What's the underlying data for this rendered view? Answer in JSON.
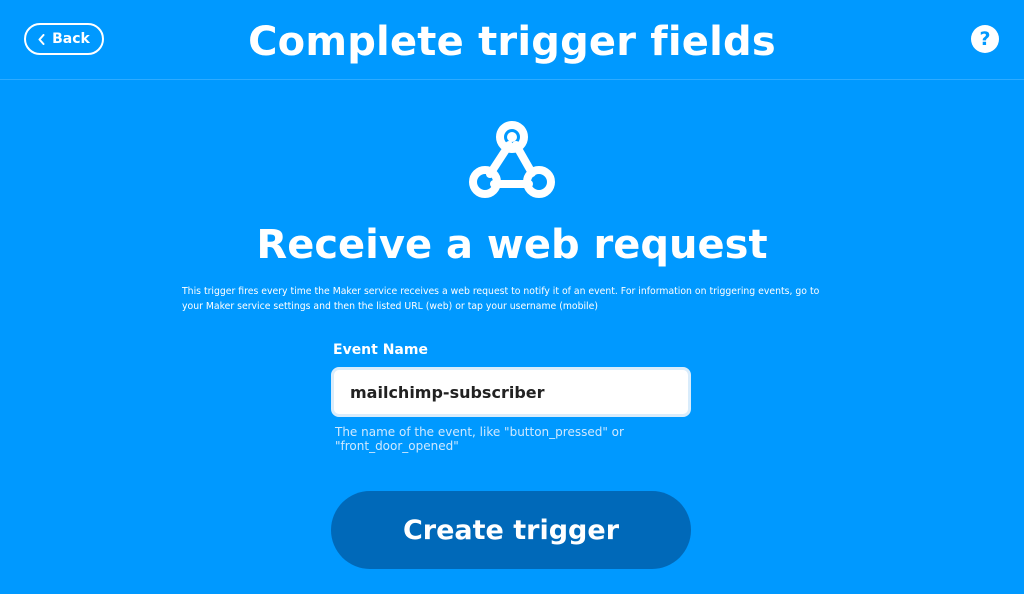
{
  "header": {
    "back_label": "Back",
    "title": "Complete trigger fields",
    "help_label": "?"
  },
  "trigger": {
    "icon": "webhook-icon",
    "title": "Receive a web request",
    "description": "This trigger fires every time the Maker service receives a web request to notify it of an event. For information on triggering events, go to your Maker service settings and then the listed URL (web) or tap your username (mobile)"
  },
  "form": {
    "event_name_label": "Event Name",
    "event_name_value": "mailchimp-subscriber",
    "event_name_help": "The name of the event, like \"button_pressed\" or \"front_door_opened\""
  },
  "actions": {
    "create_label": "Create trigger"
  },
  "colors": {
    "background": "#0099ff",
    "button": "#0069b9",
    "text": "#ffffff"
  }
}
